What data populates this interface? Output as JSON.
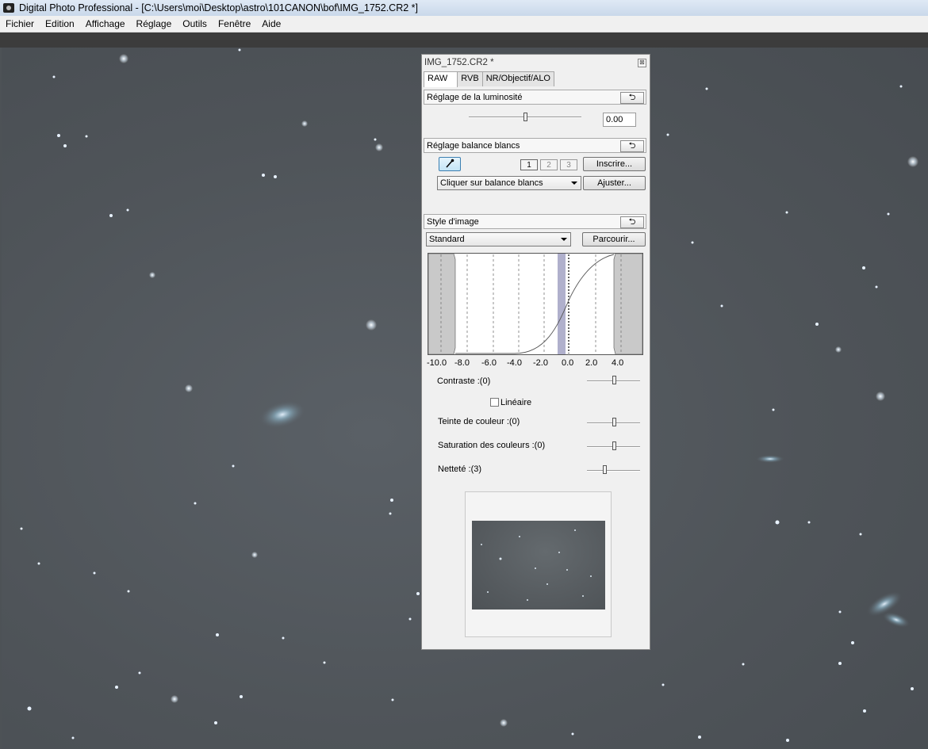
{
  "app": {
    "title": "Digital Photo Professional - [C:\\Users\\moi\\Desktop\\astro\\101CANON\\bof\\IMG_1752.CR2 *]",
    "icon": "camera-icon"
  },
  "menu": [
    "Fichier",
    "Edition",
    "Affichage",
    "Réglage",
    "Outils",
    "Fenêtre",
    "Aide"
  ],
  "panel": {
    "title": "IMG_1752.CR2 *",
    "close_glyph": "⊠",
    "tabs": [
      {
        "label": "RAW",
        "active": true
      },
      {
        "label": "RVB",
        "active": false
      },
      {
        "label": "NR/Objectif/ALO",
        "active": false
      }
    ],
    "brightness": {
      "header": "Réglage de la luminosité",
      "reset_glyph": "⮌",
      "value": "0.00",
      "slider_level": 0.5
    },
    "white_balance": {
      "header": "Réglage balance blancs",
      "reset_glyph": "⮌",
      "presets": [
        "1",
        "2",
        "3"
      ],
      "register_label": "Inscrire...",
      "mode": "Cliquer sur balance blancs",
      "adjust_label": "Ajuster..."
    },
    "picture_style": {
      "header": "Style d'image",
      "reset_glyph": "⮌",
      "style": "Standard",
      "browse_label": "Parcourir...",
      "axis_ticks": [
        "-10.0",
        "-8.0",
        "-6.0",
        "-4.0",
        "-2.0",
        "0.0",
        "2.0",
        "4.0"
      ],
      "contrast_label": "Contraste :(0)",
      "contrast_level": 0.5,
      "linear_label": "Linéaire",
      "linear_checked": false,
      "hue_label": "Teinte de couleur :(0)",
      "hue_level": 0.5,
      "saturation_label": "Saturation des couleurs :(0)",
      "saturation_level": 0.5,
      "sharpness_label": "Netteté :(3)",
      "sharpness_level": 0.3
    }
  },
  "colors": {
    "sky": "#4f5459",
    "panel_bg": "#f0f0f0",
    "histogram_peak": "#b0b0cc"
  }
}
